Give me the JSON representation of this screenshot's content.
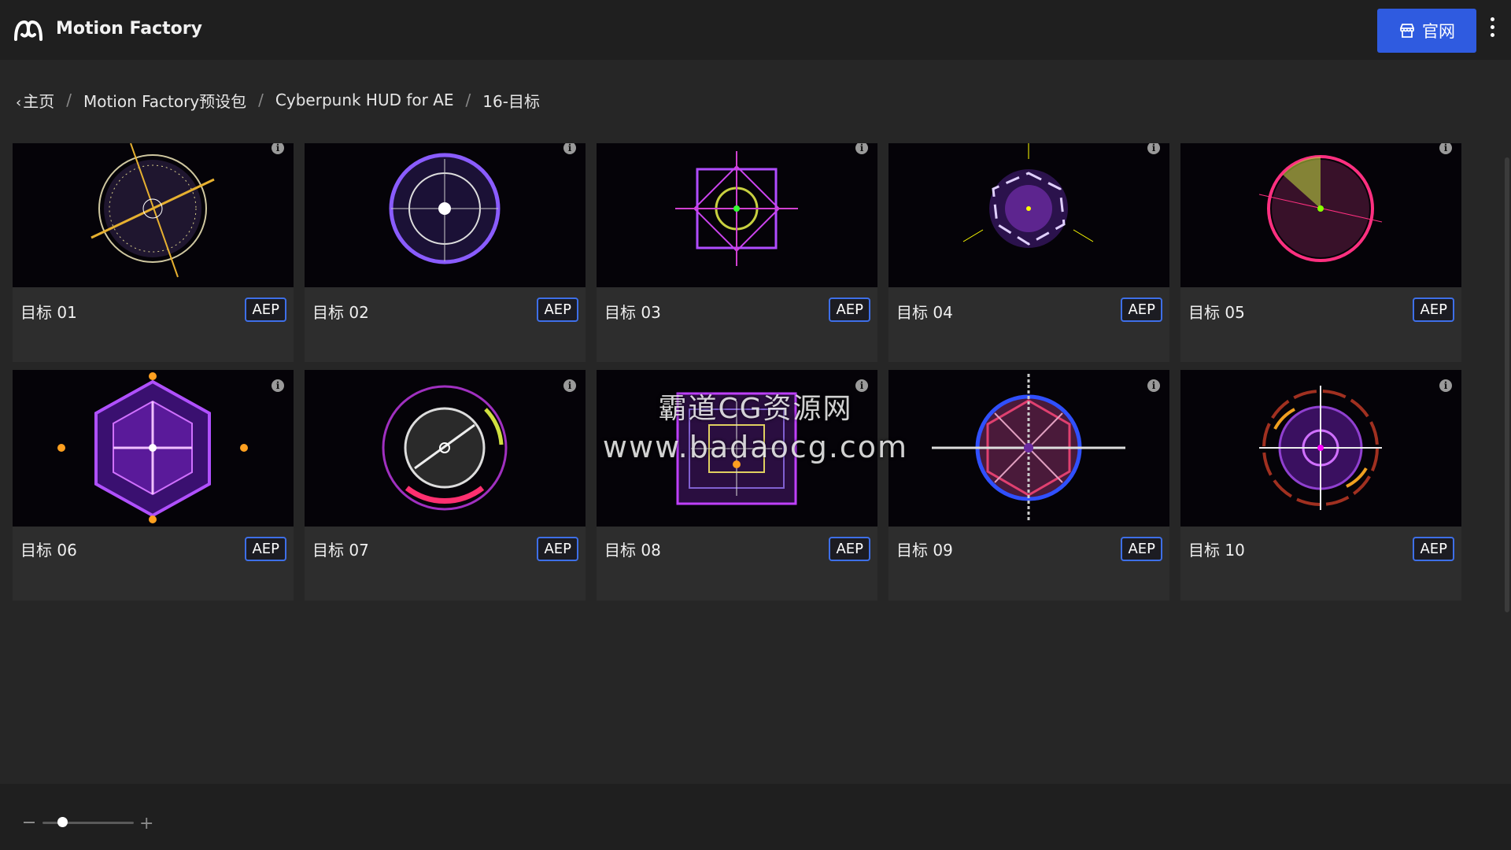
{
  "header": {
    "app_name": "Motion Factory",
    "site_button_label": "官网"
  },
  "breadcrumb": [
    "主页",
    "Motion Factory预设包",
    "Cyberpunk HUD for AE",
    "16-目标"
  ],
  "items": [
    {
      "title": "目标 01",
      "badge": "AEP"
    },
    {
      "title": "目标 02",
      "badge": "AEP"
    },
    {
      "title": "目标 03",
      "badge": "AEP"
    },
    {
      "title": "目标 04",
      "badge": "AEP"
    },
    {
      "title": "目标 05",
      "badge": "AEP"
    },
    {
      "title": "目标 06",
      "badge": "AEP"
    },
    {
      "title": "目标 07",
      "badge": "AEP"
    },
    {
      "title": "目标 08",
      "badge": "AEP"
    },
    {
      "title": "目标 09",
      "badge": "AEP"
    },
    {
      "title": "目标 10",
      "badge": "AEP"
    }
  ],
  "watermark": {
    "line1": "霸道CG资源网",
    "line2": "www.badaocg.com"
  },
  "zoom": {
    "level": 0.2
  },
  "colors": {
    "accent": "#2f5be0",
    "badge_border": "#3e6fe8"
  }
}
